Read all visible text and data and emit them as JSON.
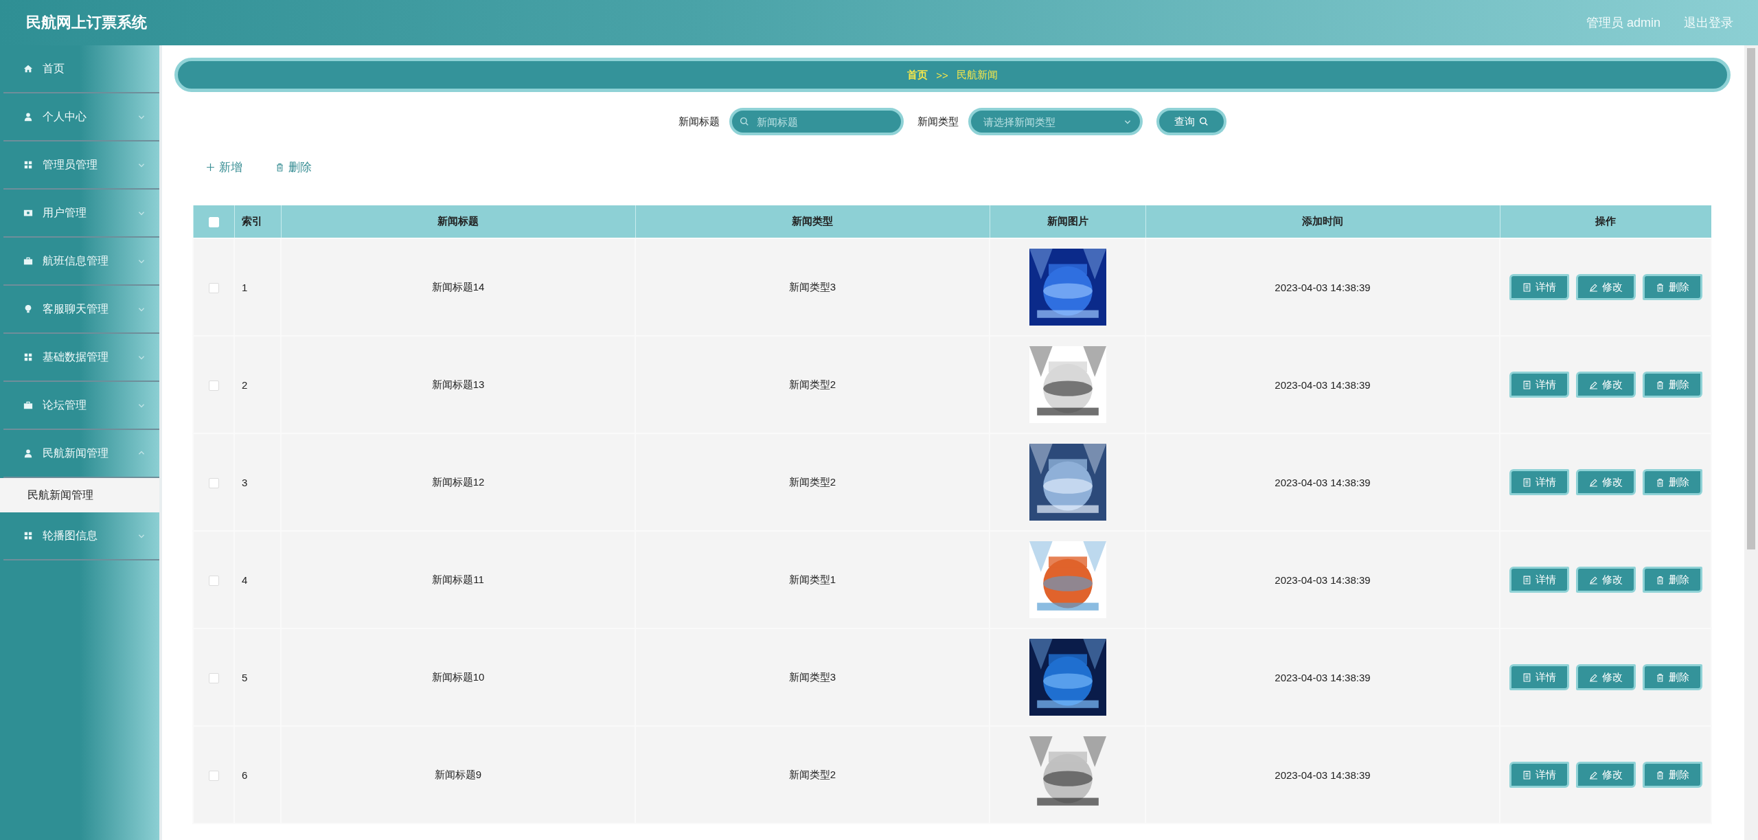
{
  "header": {
    "title": "民航网上订票系统",
    "user": "管理员 admin",
    "logout": "退出登录"
  },
  "sidebar": {
    "items": [
      {
        "label": "首页",
        "kind": "link"
      },
      {
        "label": "个人中心",
        "kind": "submenu",
        "expanded": false
      },
      {
        "label": "管理员管理",
        "kind": "submenu",
        "expanded": false
      },
      {
        "label": "用户管理",
        "kind": "submenu",
        "expanded": false
      },
      {
        "label": "航班信息管理",
        "kind": "submenu",
        "expanded": false
      },
      {
        "label": "客服聊天管理",
        "kind": "submenu",
        "expanded": false
      },
      {
        "label": "基础数据管理",
        "kind": "submenu",
        "expanded": false
      },
      {
        "label": "论坛管理",
        "kind": "submenu",
        "expanded": false
      },
      {
        "label": "民航新闻管理",
        "kind": "submenu",
        "expanded": true,
        "children": [
          {
            "label": "民航新闻管理",
            "selected": true
          }
        ]
      },
      {
        "label": "轮播图信息",
        "kind": "submenu",
        "expanded": false
      }
    ]
  },
  "breadcrumb": [
    "首页",
    ">>",
    "民航新闻"
  ],
  "search": {
    "title_label": "新闻标题",
    "title_placeholder": "新闻标题",
    "type_label": "新闻类型",
    "type_placeholder": "请选择新闻类型",
    "button": "查询"
  },
  "toolbar": {
    "add": "新增",
    "delete": "删除"
  },
  "table": {
    "all_checked": false,
    "columns": [
      "索引",
      "新闻标题",
      "新闻类型",
      "新闻图片",
      "添加时间",
      "操作"
    ],
    "rows": [
      {
        "checked": false,
        "index": "1",
        "title": "新闻标题14",
        "type": "新闻类型3",
        "time": "2023-04-03 14:38:39",
        "actions": [
          "详情",
          "修改",
          "删除"
        ]
      },
      {
        "checked": false,
        "index": "2",
        "title": "新闻标题13",
        "type": "新闻类型2",
        "time": "2023-04-03 14:38:39",
        "actions": [
          "详情",
          "修改",
          "删除"
        ]
      },
      {
        "checked": false,
        "index": "3",
        "title": "新闻标题12",
        "type": "新闻类型2",
        "time": "2023-04-03 14:38:39",
        "actions": [
          "详情",
          "修改",
          "删除"
        ]
      },
      {
        "checked": false,
        "index": "4",
        "title": "新闻标题11",
        "type": "新闻类型1",
        "time": "2023-04-03 14:38:39",
        "actions": [
          "详情",
          "修改",
          "删除"
        ]
      },
      {
        "checked": false,
        "index": "5",
        "title": "新闻标题10",
        "type": "新闻类型3",
        "time": "2023-04-03 14:38:39",
        "actions": [
          "详情",
          "修改",
          "删除"
        ]
      },
      {
        "checked": false,
        "index": "6",
        "title": "新闻标题9",
        "type": "新闻类型2",
        "time": "2023-04-03 14:38:39",
        "actions": [
          "详情",
          "修改",
          "删除"
        ]
      }
    ]
  }
}
